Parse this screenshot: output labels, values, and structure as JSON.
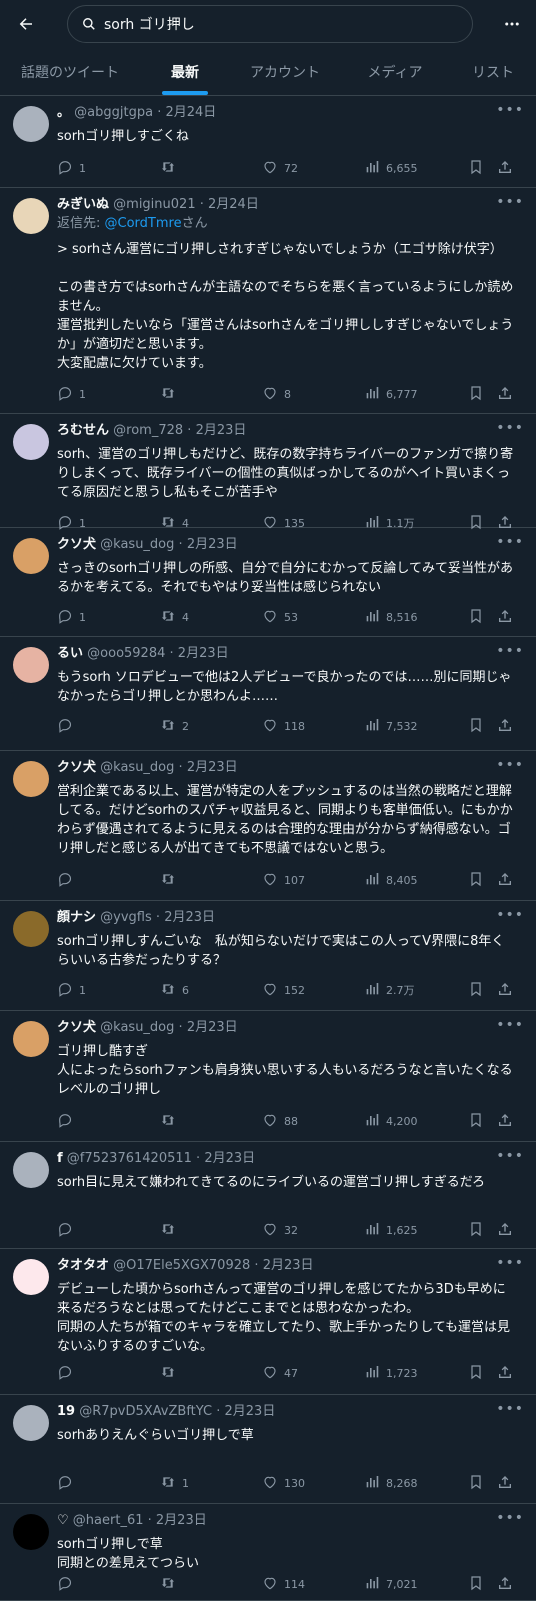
{
  "search": {
    "query": "sorh ゴリ押し"
  },
  "tabs": [
    {
      "label": "話題のツイート"
    },
    {
      "label": "最新"
    },
    {
      "label": "アカウント"
    },
    {
      "label": "メディア"
    },
    {
      "label": "リスト"
    }
  ],
  "tweets": [
    {
      "name": "。",
      "handle": "@abggjtgpa",
      "date": "2月24日",
      "reply_prefix": "",
      "reply_handle": "",
      "reply_suffix": "",
      "text": "sorhゴリ押しすごくね",
      "replies": "1",
      "retweets": "",
      "likes": "72",
      "views": "6,655",
      "avatar_color": "#aab2bd"
    },
    {
      "name": "みぎいぬ",
      "handle": "@miginu021",
      "date": "2月24日",
      "reply_prefix": "返信先: ",
      "reply_handle": "@CordTmre",
      "reply_suffix": "さん",
      "text": "> sorhさん運営にゴリ押しされすぎじゃないでしょうか（エゴサ除け伏字）\n\nこの書き方ではsorhさんが主語なのでそちらを悪く言っているようにしか読めません。\n運営批判したいなら「運営さんはsorhさんをゴリ押ししすぎじゃないでしょうか」が適切だと思います。\n大変配慮に欠けています。",
      "replies": "1",
      "retweets": "",
      "likes": "8",
      "views": "6,777",
      "avatar_color": "#e8d6b8"
    },
    {
      "name": "ろむせん",
      "handle": "@rom_728",
      "date": "2月23日",
      "reply_prefix": "",
      "reply_handle": "",
      "reply_suffix": "",
      "text": "sorh、運営のゴリ押しもだけど、既存の数字持ちライバーのファンガで擦り寄りしまくって、既存ライバーの個性の真似ばっかしてるのがヘイト買いまくってる原因だと思うし私もそこが苦手や",
      "replies": "1",
      "retweets": "4",
      "likes": "135",
      "views": "1.1万",
      "avatar_color": "#c9c6e0"
    },
    {
      "name": "クソ犬",
      "handle": "@kasu_dog",
      "date": "2月23日",
      "reply_prefix": "",
      "reply_handle": "",
      "reply_suffix": "",
      "text": "さっきのsorhゴリ押しの所感、自分で自分にむかって反論してみて妥当性があるかを考えてる。それでもやはり妥当性は感じられない",
      "replies": "1",
      "retweets": "4",
      "likes": "53",
      "views": "8,516",
      "avatar_color": "#d9a066"
    },
    {
      "name": "るい",
      "handle": "@ooo59284",
      "date": "2月23日",
      "reply_prefix": "",
      "reply_handle": "",
      "reply_suffix": "",
      "text": "もうsorh ソロデビューで他は2人デビューで良かったのでは……別に同期じゃなかったらゴリ押しとか思わんよ……",
      "replies": "",
      "retweets": "2",
      "likes": "118",
      "views": "7,532",
      "avatar_color": "#e6b3a3"
    },
    {
      "name": "クソ犬",
      "handle": "@kasu_dog",
      "date": "2月23日",
      "reply_prefix": "",
      "reply_handle": "",
      "reply_suffix": "",
      "text": "営利企業である以上、運営が特定の人をプッシュするのは当然の戦略だと理解してる。だけどsorhのスパチャ収益見ると、同期よりも客単価低い。にもかかわらず優遇されてるように見えるのは合理的な理由が分からず納得感ない。ゴリ押しだと感じる人が出てきても不思議ではないと思う。",
      "replies": "",
      "retweets": "",
      "likes": "107",
      "views": "8,405",
      "avatar_color": "#d9a066"
    },
    {
      "name": "顔ナシ",
      "handle": "@yvgfls",
      "date": "2月23日",
      "reply_prefix": "",
      "reply_handle": "",
      "reply_suffix": "",
      "text": "sorhゴリ押しすんごいな　私が知らないだけで実はこの人ってV界隈に8年くらいいる古参だったりする？",
      "replies": "1",
      "retweets": "6",
      "likes": "152",
      "views": "2.7万",
      "avatar_color": "#8a6a2a"
    },
    {
      "name": "クソ犬",
      "handle": "@kasu_dog",
      "date": "2月23日",
      "reply_prefix": "",
      "reply_handle": "",
      "reply_suffix": "",
      "text": "ゴリ押し酷すぎ\n人によったらsorhファンも肩身狭い思いする人もいるだろうなと言いたくなるレベルのゴリ押し",
      "replies": "",
      "retweets": "",
      "likes": "88",
      "views": "4,200",
      "avatar_color": "#d9a066"
    },
    {
      "name": "f",
      "handle": "@f7523761420511",
      "date": "2月23日",
      "reply_prefix": "",
      "reply_handle": "",
      "reply_suffix": "",
      "text": "sorh目に見えて嫌われてきてるのにライブいるの運営ゴリ押しすぎるだろ",
      "replies": "",
      "retweets": "",
      "likes": "32",
      "views": "1,625",
      "avatar_color": "#aab2bd"
    },
    {
      "name": "タオタオ",
      "handle": "@O17Ele5XGX70928",
      "date": "2月23日",
      "reply_prefix": "",
      "reply_handle": "",
      "reply_suffix": "",
      "text": "デビューした頃からsorhさんって運営のゴリ押しを感じてたから3Dも早めに来るだろうなとは思ってたけどここまでとは思わなかったわ。\n同期の人たちが箱でのキャラを確立してたり、歌上手かったりしても運営は見ないふりするのすごいな。",
      "replies": "",
      "retweets": "",
      "likes": "47",
      "views": "1,723",
      "avatar_color": "#fde8ec"
    },
    {
      "name": "19",
      "handle": "@R7pvD5XAvZBftYC",
      "date": "2月23日",
      "reply_prefix": "",
      "reply_handle": "",
      "reply_suffix": "",
      "text": "sorhありえんぐらいゴリ押しで草",
      "replies": "",
      "retweets": "1",
      "likes": "130",
      "views": "8,268",
      "avatar_color": "#aab2bd"
    },
    {
      "name": "♡",
      "handle": "@haert_61",
      "date": "2月23日",
      "reply_prefix": "",
      "reply_handle": "",
      "reply_suffix": "",
      "text": "sorhゴリ押しで草\n同期との差見えてつらい",
      "replies": "",
      "retweets": "",
      "likes": "114",
      "views": "7,021",
      "avatar_color": "#000000"
    }
  ]
}
